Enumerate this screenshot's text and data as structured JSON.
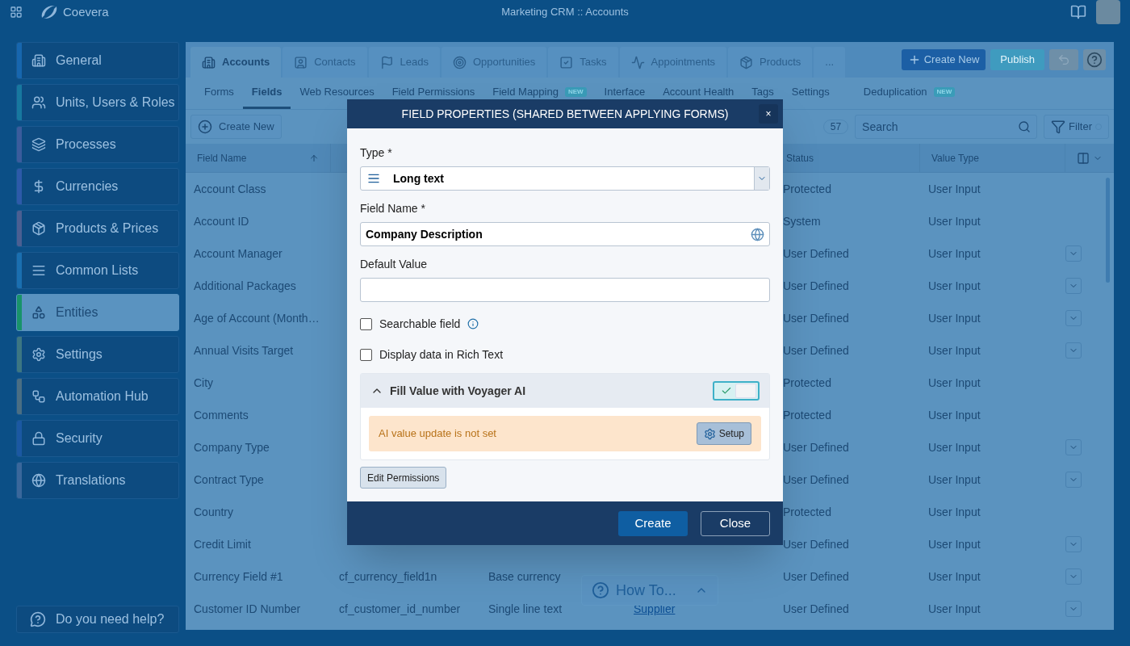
{
  "app": {
    "logo_text": "Coevera",
    "title": "Marketing CRM :: Accounts"
  },
  "sidebar": {
    "items": [
      {
        "label": "General",
        "selected": false,
        "color": "#1766ae"
      },
      {
        "label": "Units, Users & Roles",
        "selected": false,
        "color": "#17789f"
      },
      {
        "label": "Processes",
        "selected": false,
        "color": "#3b5c9c"
      },
      {
        "label": "Currencies",
        "selected": false,
        "color": "#2d5aa9"
      },
      {
        "label": "Products & Prices",
        "selected": false,
        "color": "#4b5f92"
      },
      {
        "label": "Common Lists",
        "selected": false,
        "color": "#1a6fb0"
      },
      {
        "label": "Entities",
        "selected": true,
        "color": "#18936a"
      },
      {
        "label": "Settings",
        "selected": false,
        "color": "#3c7682"
      },
      {
        "label": "Automation Hub",
        "selected": false,
        "color": "#4a6e83"
      },
      {
        "label": "Security",
        "selected": false,
        "color": "#1b58a2"
      },
      {
        "label": "Translations",
        "selected": false,
        "color": "#3a679b"
      }
    ],
    "help": "Do you need help?"
  },
  "entity_tabs": [
    {
      "label": "Accounts",
      "selected": true
    },
    {
      "label": "Contacts",
      "selected": false
    },
    {
      "label": "Leads",
      "selected": false
    },
    {
      "label": "Opportunities",
      "selected": false
    },
    {
      "label": "Tasks",
      "selected": false
    },
    {
      "label": "Appointments",
      "selected": false
    },
    {
      "label": "Products",
      "selected": false
    },
    {
      "label": "...",
      "selected": false
    }
  ],
  "actions": {
    "create_new": "Create New",
    "publish": "Publish"
  },
  "subtabs": [
    {
      "label": "Forms",
      "selected": false
    },
    {
      "label": "Fields",
      "selected": true
    },
    {
      "label": "Web Resources",
      "selected": false
    },
    {
      "label": "Field Permissions",
      "selected": false
    },
    {
      "label": "Field Mapping",
      "selected": false,
      "badge": "NEW"
    },
    {
      "label": "Interface",
      "selected": false
    },
    {
      "label": "Account Health",
      "selected": false
    },
    {
      "label": "Tags",
      "selected": false
    },
    {
      "label": "Settings",
      "selected": false
    },
    {
      "label": "Deduplication",
      "selected": false,
      "badge": "NEW"
    }
  ],
  "toolbar": {
    "create_new": "Create New",
    "count": "57",
    "search_placeholder": "Search",
    "filter": "Filter"
  },
  "table": {
    "columns": [
      {
        "label": "Field Name",
        "sorted": true
      },
      {
        "label": "Status",
        "sorted": false
      },
      {
        "label": "Value Type",
        "sorted": false
      }
    ],
    "rows": [
      {
        "field_name": "Account Class",
        "status": "Protected",
        "value_type": "User Input",
        "menu": false
      },
      {
        "field_name": "Account ID",
        "status": "System",
        "value_type": "User Input",
        "menu": false
      },
      {
        "field_name": "Account Manager",
        "status": "User Defined",
        "value_type": "User Input",
        "menu": true
      },
      {
        "field_name": "Additional Packages",
        "status": "User Defined",
        "value_type": "User Input",
        "menu": true
      },
      {
        "field_name": "Age of Account (Month…",
        "status": "User Defined",
        "value_type": "User Input",
        "menu": true
      },
      {
        "field_name": "Annual Visits Target",
        "status": "User Defined",
        "value_type": "User Input",
        "menu": true
      },
      {
        "field_name": "City",
        "status": "Protected",
        "value_type": "User Input",
        "menu": false
      },
      {
        "field_name": "Comments",
        "status": "Protected",
        "value_type": "User Input",
        "menu": false
      },
      {
        "field_name": "Company Type",
        "status": "User Defined",
        "value_type": "User Input",
        "menu": true
      },
      {
        "field_name": "Contract Type",
        "status": "User Defined",
        "value_type": "User Input",
        "menu": true
      },
      {
        "field_name": "Country",
        "status": "Protected",
        "value_type": "User Input",
        "menu": false
      },
      {
        "field_name": "Credit Limit",
        "status": "User Defined",
        "value_type": "User Input",
        "menu": true
      },
      {
        "field_name": "Currency Field #1",
        "column_2": "cf_currency_field1n",
        "column_3": "Base currency",
        "status": "User Defined",
        "value_type": "User Input",
        "menu": true
      },
      {
        "field_name": "Customer ID Number",
        "column_2": "cf_customer_id_number",
        "column_3": "Single line text",
        "column_4": "Supplier",
        "status": "User Defined",
        "value_type": "User Input",
        "menu": true
      }
    ]
  },
  "dialog": {
    "title": "FIELD PROPERTIES (SHARED BETWEEN APPLYING FORMS)",
    "close": "×",
    "fields": [
      {
        "kind": "select",
        "label": "Type *",
        "value": "Long text"
      },
      {
        "kind": "translatable",
        "label": "Field Name *",
        "value": "Company Description"
      },
      {
        "kind": "text",
        "label": "Default Value"
      }
    ],
    "checkboxes": [
      {
        "label": "Searchable field",
        "checked": false,
        "info": true
      },
      {
        "label": "Display data in Rich Text",
        "checked": false,
        "info": false
      }
    ],
    "ai": {
      "title": "Fill Value with Voyager AI",
      "expanded": true,
      "on": true,
      "notice": "AI value update is not set",
      "setup": "Setup"
    },
    "edit_permissions": "Edit Permissions",
    "buttons": {
      "create": "Create",
      "close": "Close"
    }
  },
  "how_to": {
    "label": "How To..."
  }
}
